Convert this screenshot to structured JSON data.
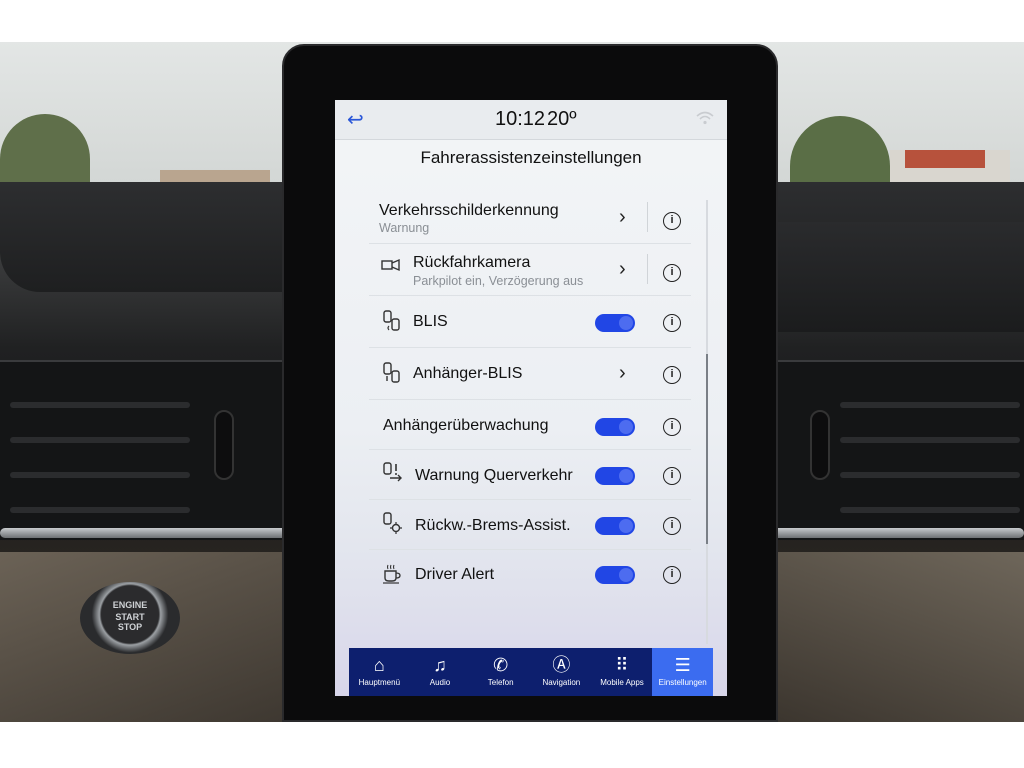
{
  "status": {
    "time": "10:12",
    "temperature": "20º"
  },
  "page": {
    "title": "Fahrerassistenzeinstellungen"
  },
  "settings": [
    {
      "label": "Verkehrsschilderkennung",
      "sub": "Warnung",
      "control": "chevron",
      "icon": "none"
    },
    {
      "label": "Rückfahrkamera",
      "sub": "Parkpilot ein, Verzögerung aus",
      "control": "chevron",
      "icon": "camera-icon"
    },
    {
      "label": "BLIS",
      "sub": "",
      "control": "toggle",
      "enabled": true,
      "icon": "blind-spot-icon"
    },
    {
      "label": "Anhänger-BLIS",
      "sub": "",
      "control": "chevron",
      "icon": "trailer-blind-spot-icon"
    },
    {
      "label": "Anhängerüberwachung",
      "sub": "",
      "control": "toggle",
      "enabled": true,
      "icon": "none"
    },
    {
      "label": "Warnung Querverkehr",
      "sub": "",
      "control": "toggle",
      "enabled": true,
      "icon": "cross-traffic-icon"
    },
    {
      "label": "Rückw.-Brems-Assist.",
      "sub": "",
      "control": "toggle",
      "enabled": true,
      "icon": "reverse-brake-icon"
    },
    {
      "label": "Driver Alert",
      "sub": "",
      "control": "toggle",
      "enabled": true,
      "icon": "coffee-cup-icon"
    }
  ],
  "nav": [
    {
      "label": "Hauptmenü",
      "icon": "home-icon"
    },
    {
      "label": "Audio",
      "icon": "music-note-icon"
    },
    {
      "label": "Telefon",
      "icon": "phone-icon"
    },
    {
      "label": "Navigation",
      "icon": "navigation-icon"
    },
    {
      "label": "Mobile Apps",
      "icon": "apps-grid-icon"
    },
    {
      "label": "Einstellungen",
      "icon": "settings-sliders-icon",
      "active": true
    }
  ],
  "start_button": {
    "line1": "ENGINE",
    "line2": "START",
    "line3": "STOP"
  },
  "colors": {
    "accent": "#2146e5",
    "nav_bg": "#0d1f6e",
    "nav_active": "#3b6cf0"
  }
}
